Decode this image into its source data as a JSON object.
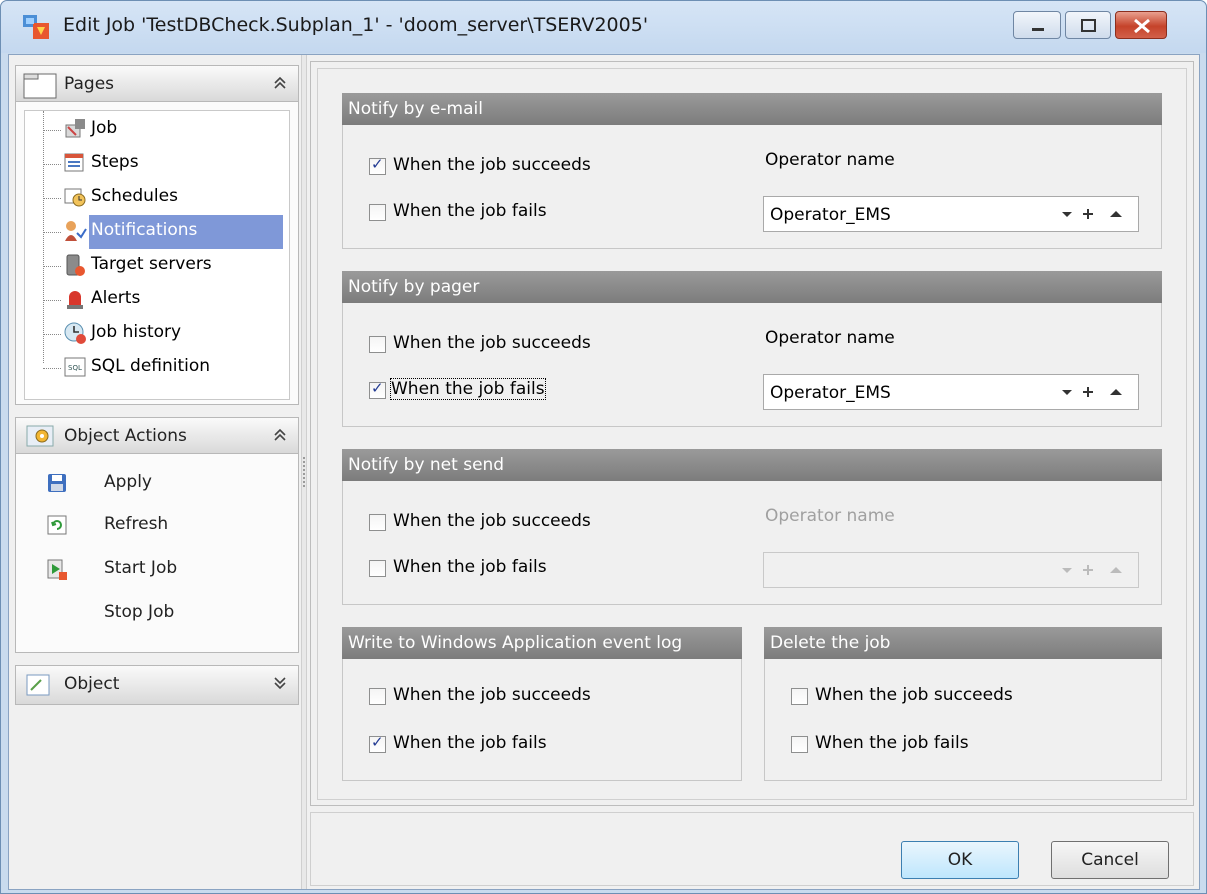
{
  "window": {
    "title": "Edit Job 'TestDBCheck.Subplan_1' - 'doom_server\\TSERV2005'"
  },
  "pages_panel": {
    "title": "Pages",
    "items": [
      {
        "label": "Job",
        "icon": "job-icon"
      },
      {
        "label": "Steps",
        "icon": "steps-icon"
      },
      {
        "label": "Schedules",
        "icon": "schedules-icon"
      },
      {
        "label": "Notifications",
        "icon": "notifications-icon",
        "selected": true
      },
      {
        "label": "Target servers",
        "icon": "target-servers-icon"
      },
      {
        "label": "Alerts",
        "icon": "alerts-icon"
      },
      {
        "label": "Job history",
        "icon": "job-history-icon"
      },
      {
        "label": "SQL definition",
        "icon": "sql-definition-icon"
      }
    ]
  },
  "actions_panel": {
    "title": "Object Actions",
    "items": [
      {
        "label": "Apply",
        "icon": "save-icon"
      },
      {
        "label": "Refresh",
        "icon": "refresh-icon"
      },
      {
        "label": "Start Job",
        "icon": "start-job-icon"
      },
      {
        "label": "Stop Job",
        "icon": ""
      }
    ]
  },
  "object_panel": {
    "title": "Object"
  },
  "email": {
    "title": "Notify by e-mail",
    "succeeds_label": "When the job succeeds",
    "succeeds_checked": true,
    "fails_label": "When the job fails",
    "fails_checked": false,
    "operator_label": "Operator name",
    "operator_value": "Operator_EMS"
  },
  "pager": {
    "title": "Notify by pager",
    "succeeds_label": "When the job succeeds",
    "succeeds_checked": false,
    "fails_label": "When the job fails",
    "fails_checked": true,
    "operator_label": "Operator name",
    "operator_value": "Operator_EMS"
  },
  "netsend": {
    "title": "Notify by net send",
    "succeeds_label": "When the job succeeds",
    "succeeds_checked": false,
    "fails_label": "When the job fails",
    "fails_checked": false,
    "operator_label": "Operator name",
    "operator_value": ""
  },
  "eventlog": {
    "title": "Write to Windows Application event log",
    "succeeds_label": "When the job succeeds",
    "succeeds_checked": false,
    "fails_label": "When the job fails",
    "fails_checked": true
  },
  "delete": {
    "title": "Delete the job",
    "succeeds_label": "When the job succeeds",
    "succeeds_checked": false,
    "fails_label": "When the job fails",
    "fails_checked": false
  },
  "buttons": {
    "ok": "OK",
    "cancel": "Cancel"
  },
  "colors": {
    "selection": "#7f98d8",
    "group_header": "#8a8a8a",
    "check_mark": "#233b93"
  }
}
